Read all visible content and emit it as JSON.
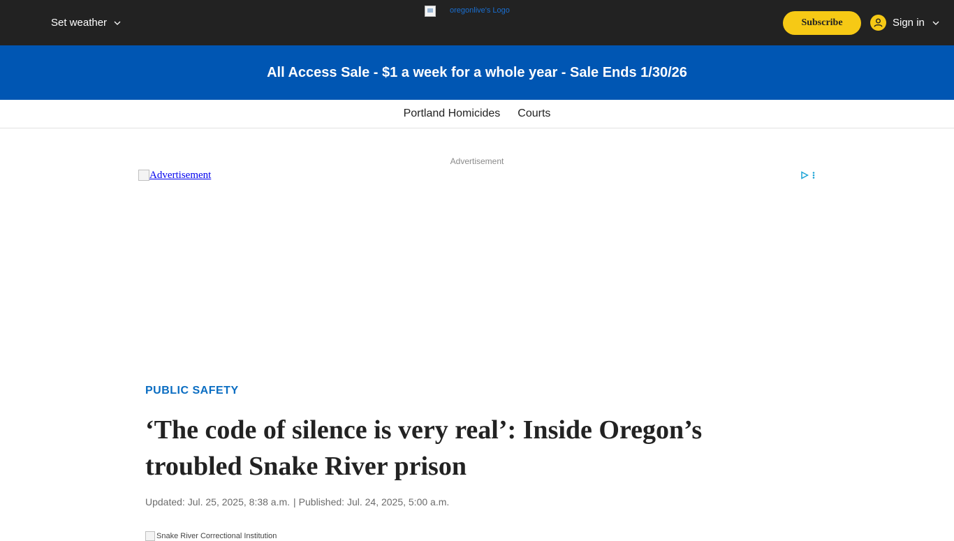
{
  "header": {
    "weather_label": "Set weather",
    "logo_alt": "oregonlive's Logo",
    "subscribe_label": "Subscribe",
    "signin_label": "Sign in"
  },
  "promo": {
    "text": "All Access Sale - $1 a week for a whole year - Sale Ends 1/30/26"
  },
  "subnav": {
    "items": [
      {
        "label": "Portland Homicides"
      },
      {
        "label": "Courts"
      }
    ]
  },
  "ad": {
    "label": "Advertisement",
    "image_alt": "Advertisement"
  },
  "article": {
    "section": "PUBLIC SAFETY",
    "headline": "‘The code of silence is very real’: Inside Oregon’s troubled Snake River prison",
    "updated": "Updated: Jul. 25, 2025, 8:38 a.m.",
    "separator": "|",
    "published": "Published: Jul. 24, 2025, 5:00 a.m.",
    "photo_alt": "Snake River Correctional Institution"
  },
  "colors": {
    "header_bg": "#222222",
    "promo_bg": "#0056b3",
    "subscribe_bg": "#f6c915",
    "section_link": "#0a6dc2",
    "adchoices": "#1aa3d6"
  },
  "icons": {
    "weather_dropdown": "chevron-down-icon",
    "user": "user-icon",
    "signin_dropdown": "chevron-down-icon",
    "adchoices": "adchoices-icon",
    "ad_menu": "kebab-menu-icon"
  }
}
